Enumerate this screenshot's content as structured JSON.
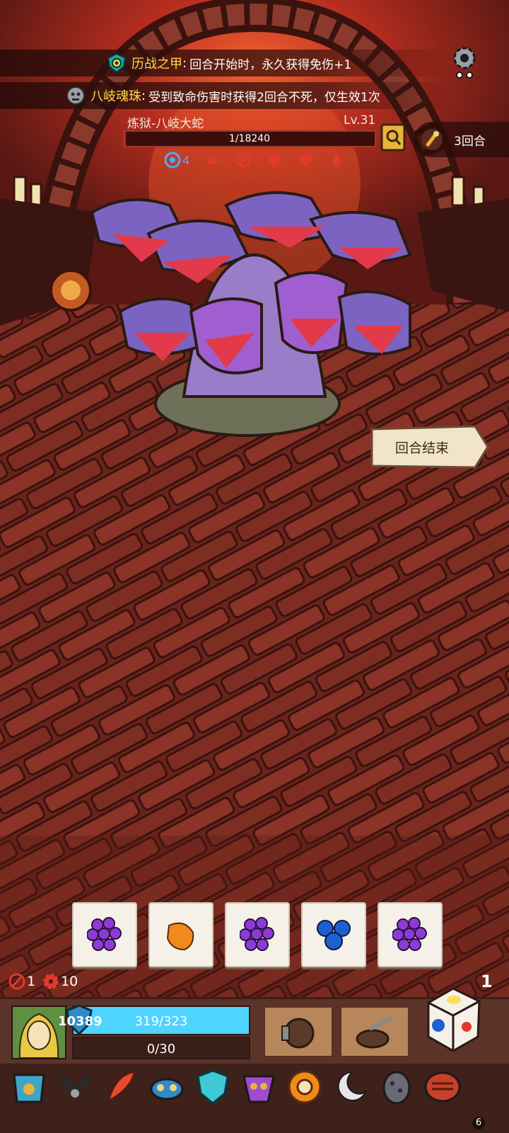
{
  "top_effects": [
    {
      "icon": "shield-eye-icon",
      "name": "历战之甲",
      "text": "回合开始时，永久获得免伤+1"
    },
    {
      "icon": "beast-skull-icon",
      "name": "八岐魂珠",
      "text": "受到致命伤害时获得2回合不死，仅生效1次"
    }
  ],
  "boss": {
    "name": "炼狱-八岐大蛇",
    "level": "Lv.31",
    "hp_text": "1/18240",
    "hp_fraction": 0.0001,
    "status_first_count": "4"
  },
  "round": {
    "label": "3回合"
  },
  "end_turn": {
    "label": "回合结束"
  },
  "dice": [
    {
      "icon": "grape-icon",
      "color": "#8e3bd6"
    },
    {
      "icon": "orange-fruit-icon",
      "color": "#f08a1c"
    },
    {
      "icon": "grape-icon",
      "color": "#8e3bd6"
    },
    {
      "icon": "blueberry-icon",
      "color": "#1f5fd0"
    },
    {
      "icon": "grape-icon",
      "color": "#8e3bd6"
    }
  ],
  "stats": {
    "attack": "1",
    "gear": "10",
    "corner": "1"
  },
  "player": {
    "shield_value": "10389",
    "hp_text": "319/323",
    "xp_text": "0/30"
  },
  "relics_count": "6",
  "colors": {
    "hp_cyan": "#4fd4ff",
    "boss_hp": "#c0291d",
    "accent_gold": "#ffd84a"
  }
}
